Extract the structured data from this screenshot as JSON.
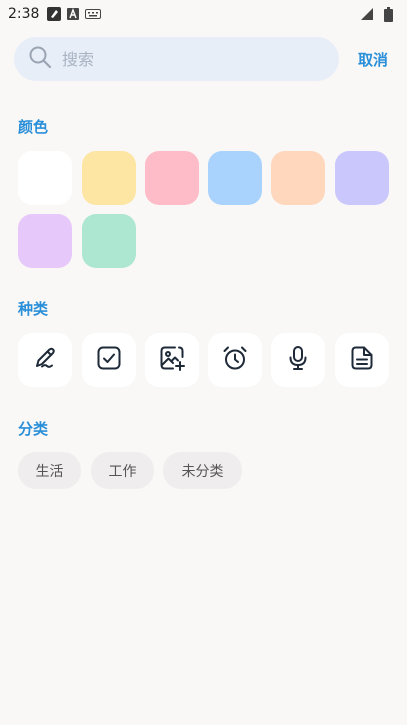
{
  "status_bar": {
    "time": "2:38"
  },
  "search": {
    "placeholder": "搜索",
    "cancel_label": "取消"
  },
  "colors_section": {
    "title": "颜色",
    "swatches": [
      "#ffffff",
      "#fde6a3",
      "#fdbcc7",
      "#a9d3fd",
      "#fed7bd",
      "#c9c7fb",
      "#e6c9fa",
      "#ade6d1"
    ]
  },
  "types_section": {
    "title": "种类",
    "items": [
      "pencil-icon",
      "checkbox-icon",
      "image-add-icon",
      "alarm-icon",
      "microphone-icon",
      "document-icon"
    ]
  },
  "categories_section": {
    "title": "分类",
    "chips": [
      "生活",
      "工作",
      "未分类"
    ]
  },
  "accent_color": "#2a8fd9"
}
